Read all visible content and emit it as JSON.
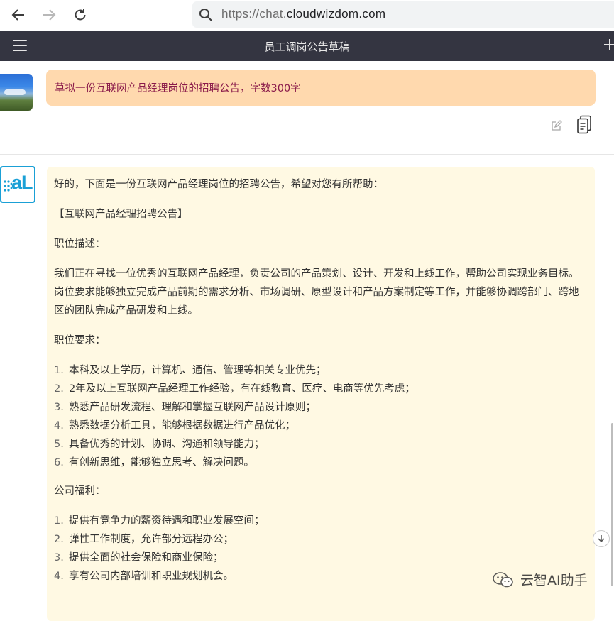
{
  "browser": {
    "url_prefix": "https://chat.",
    "url_domain": "cloudwizdom.com",
    "icons": [
      "back-icon",
      "forward-icon",
      "reload-icon",
      "search-icon"
    ]
  },
  "header": {
    "title": "员工调岗公告草稿",
    "icons": [
      "menu-icon",
      "plus-icon"
    ]
  },
  "user_message": {
    "text": "草拟一份互联网产品经理岗位的招聘公告，字数300字",
    "actions": [
      "edit-icon",
      "copy-icon"
    ]
  },
  "ai_message": {
    "avatar_text": "aL",
    "intro": "好的，下面是一份互联网产品经理岗位的招聘公告，希望对您有所帮助：",
    "heading": "【互联网产品经理招聘公告】",
    "desc_title": "职位描述：",
    "desc_text": "我们正在寻找一位优秀的互联网产品经理，负责公司的产品策划、设计、开发和上线工作，帮助公司实现业务目标。岗位要求能够独立完成产品前期的需求分析、市场调研、原型设计和产品方案制定等工作，并能够协调跨部门、跨地区的团队完成产品研发和上线。",
    "req_title": "职位要求：",
    "requirements": [
      {
        "num": "1.",
        "text": "本科及以上学历，计算机、通信、管理等相关专业优先；"
      },
      {
        "num": "2.",
        "text": "2年及以上互联网产品经理工作经验，有在线教育、医疗、电商等优先考虑；"
      },
      {
        "num": "3.",
        "text": "熟悉产品研发流程、理解和掌握互联网产品设计原则；"
      },
      {
        "num": "4.",
        "text": "熟悉数据分析工具，能够根据数据进行产品优化；"
      },
      {
        "num": "5.",
        "text": "具备优秀的计划、协调、沟通和领导能力；"
      },
      {
        "num": "6.",
        "text": "有创新思维，能够独立思考、解决问题。"
      }
    ],
    "benefit_title": "公司福利：",
    "benefits": [
      {
        "num": "1.",
        "text": "提供有竞争力的薪资待遇和职业发展空间；"
      },
      {
        "num": "2.",
        "text": "弹性工作制度，允许部分远程办公；"
      },
      {
        "num": "3.",
        "text": "提供全面的社会保险和商业保险；"
      },
      {
        "num": "4.",
        "text": "享有公司内部培训和职业规划机会。"
      }
    ]
  },
  "watermark": {
    "text": "云智AI助手"
  },
  "colors": {
    "header_bg": "#343541",
    "user_bubble": "#ffd9ae",
    "user_text": "#8a1a4a",
    "ai_bubble": "#fff9e3",
    "ai_accent": "#1aa0d6"
  }
}
